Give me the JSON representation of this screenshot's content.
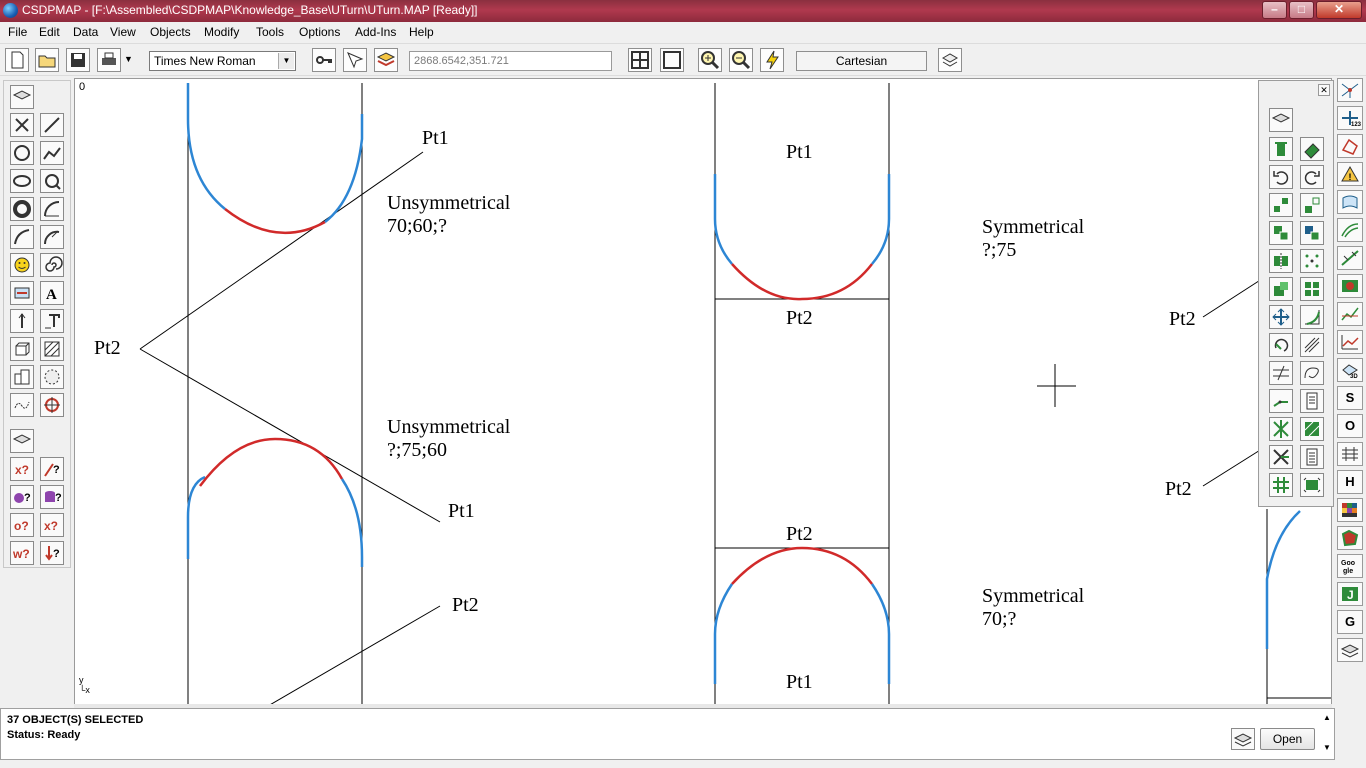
{
  "window": {
    "title": "CSDPMAP - [F:\\Assembled\\CSDPMAP\\Knowledge_Base\\UTurn\\UTurn.MAP [Ready]]",
    "minimize": "–",
    "maximize": "□",
    "close": "✕"
  },
  "menu": [
    "File",
    "Edit",
    "Data",
    "View",
    "Objects",
    "Modify",
    "Tools",
    "Options",
    "Add-Ins",
    "Help"
  ],
  "toolbar": {
    "font": "Times New Roman",
    "coordinates": "2868.6542,351.721",
    "projection": "Cartesian",
    "icons": [
      "new-icon",
      "open-icon",
      "save-icon",
      "print-icon",
      "dropdown-icon",
      "key-icon",
      "select-tool-icon",
      "layers-icon",
      "grid-icon",
      "frame-icon",
      "zoom-in-icon",
      "zoom-out-icon",
      "lightning-icon",
      "map-icon"
    ]
  },
  "canvas": {
    "origin_label": "0",
    "axis_y": "y",
    "axis_x": "x",
    "labels": {
      "pt1_a": "Pt1",
      "unsym1_title": "Unsymmetrical",
      "unsym1_value": "70;60;?",
      "pt2_a": "Pt2",
      "unsym2_title": "Unsymmetrical",
      "unsym2_value": "?;75;60",
      "pt1_b": "Pt1",
      "pt2_b": "Pt2",
      "pt1_c": "Pt1",
      "pt2_c": "Pt2",
      "pt2_d": "Pt2",
      "pt1_d": "Pt1",
      "sym1_title": "Symmetrical",
      "sym1_value": "?;75",
      "sym2_title": "Symmetrical",
      "sym2_value": "70;?",
      "pt2_e": "Pt2",
      "pt2_f": "Pt2"
    },
    "colors": {
      "arc_red": "#d12a2a",
      "arc_blue": "#2d86d4"
    }
  },
  "status": {
    "selection": "37 OBJECT(S) SELECTED",
    "state": "Status: Ready",
    "open_button": "Open"
  },
  "floating_panel": {
    "close": "✕"
  },
  "right_tools": [
    "S",
    "O",
    "H",
    "G"
  ]
}
